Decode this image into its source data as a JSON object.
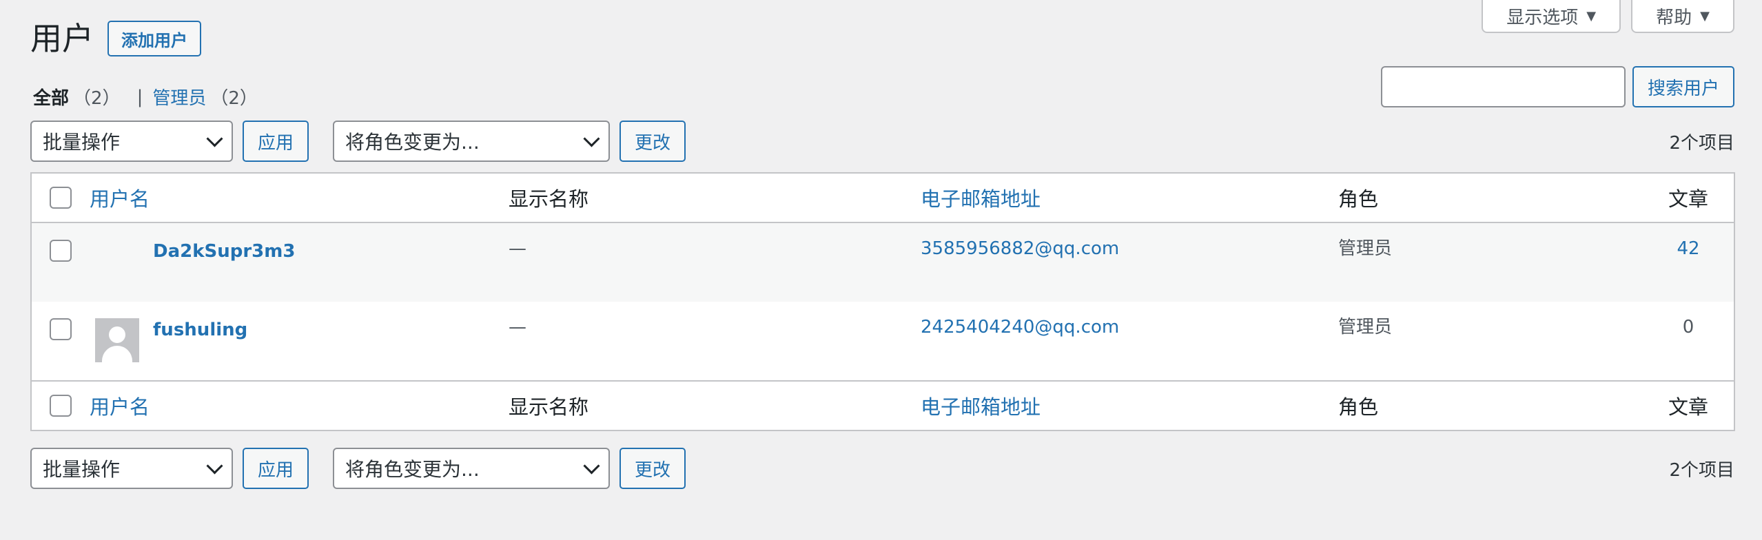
{
  "screen_meta": {
    "screen_options_label": "显示选项",
    "help_label": "帮助"
  },
  "header": {
    "title": "用户",
    "add_new_label": "添加用户"
  },
  "filters": {
    "all_label": "全部",
    "all_count": "（2）",
    "separator": "|",
    "admin_label": "管理员",
    "admin_count": "（2）"
  },
  "search": {
    "input_value": "",
    "button_label": "搜索用户"
  },
  "tablenav_top": {
    "bulk_action_selected": "批量操作",
    "apply_label": "应用",
    "role_change_selected": "将角色变更为...",
    "change_label": "更改",
    "item_count": "2个项目"
  },
  "table": {
    "columns": {
      "username": "用户名",
      "name": "显示名称",
      "email": "电子邮箱地址",
      "role": "角色",
      "posts": "文章"
    },
    "rows": [
      {
        "username": "Da2kSupr3m3",
        "name": "—",
        "email": "3585956882@qq.com",
        "role": "管理员",
        "posts": "42"
      },
      {
        "username": "fushuling",
        "name": "—",
        "email": "2425404240@qq.com",
        "role": "管理员",
        "posts": "0"
      }
    ]
  },
  "tablenav_bottom": {
    "bulk_action_selected": "批量操作",
    "apply_label": "应用",
    "role_change_selected": "将角色变更为...",
    "change_label": "更改",
    "item_count": "2个项目"
  },
  "colors": {
    "accent": "#2271b1",
    "background": "#f0f0f1",
    "border": "#c3c4c7"
  }
}
